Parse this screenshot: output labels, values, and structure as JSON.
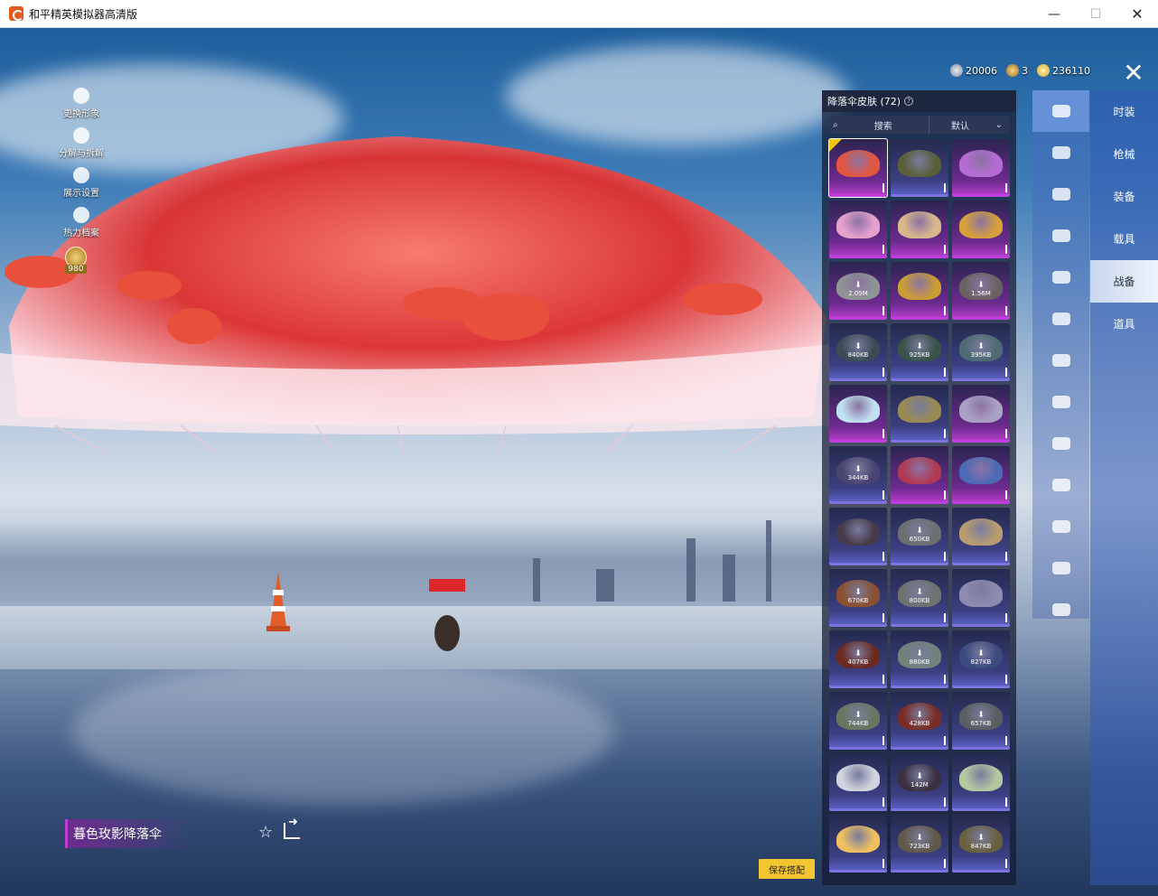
{
  "window": {
    "title": "和平精英模拟器高清版",
    "minimize_glyph": "—",
    "maximize_glyph": "☐",
    "close_glyph": "✕"
  },
  "left_menu": {
    "items": [
      {
        "label": "更换形象",
        "icon": "avatar-icon"
      },
      {
        "label": "分解与拆解",
        "icon": "puzzle-icon"
      },
      {
        "label": "展示设置",
        "icon": "eye-icon"
      },
      {
        "label": "热力档案",
        "icon": "flame-icon"
      }
    ],
    "badge_value": "980"
  },
  "currency": {
    "items": [
      {
        "value": "20006",
        "icon": "silver-coin-icon"
      },
      {
        "value": "3",
        "icon": "gold-token-icon"
      },
      {
        "value": "236110",
        "icon": "coupon-icon"
      }
    ]
  },
  "close_label": "✕",
  "skin_panel": {
    "title": "降落伞皮肤 (72)",
    "search_placeholder": "搜索",
    "sort_label": "默认",
    "slots": [
      {
        "rarity": "purple",
        "color": "#e2553e",
        "selected": true,
        "download": ""
      },
      {
        "rarity": "blue",
        "color": "#5a5f3a",
        "download": ""
      },
      {
        "rarity": "purple",
        "color": "#b46cd4",
        "download": ""
      },
      {
        "rarity": "purple",
        "color": "#e6a1cc",
        "download": ""
      },
      {
        "rarity": "purple",
        "color": "#d8b88a",
        "download": ""
      },
      {
        "rarity": "purple",
        "color": "#d6a03a",
        "download": ""
      },
      {
        "rarity": "purple",
        "color": "#8e9494",
        "download": "2.09M"
      },
      {
        "rarity": "purple",
        "color": "#c99c34",
        "download": ""
      },
      {
        "rarity": "purple",
        "color": "#6a6262",
        "download": "1.56M"
      },
      {
        "rarity": "blue",
        "color": "#3c4a54",
        "download": "840KB"
      },
      {
        "rarity": "blue",
        "color": "#39524a",
        "download": "925KB"
      },
      {
        "rarity": "blue",
        "color": "#4e6a72",
        "download": "395KB"
      },
      {
        "rarity": "purple",
        "color": "#bfe0f0",
        "download": ""
      },
      {
        "rarity": "blue",
        "color": "#9a8a52",
        "download": ""
      },
      {
        "rarity": "purple",
        "color": "#a9a2c4",
        "download": ""
      },
      {
        "rarity": "blue",
        "color": "#4a4470",
        "download": "344KB"
      },
      {
        "rarity": "purple",
        "color": "#b03a54",
        "download": ""
      },
      {
        "rarity": "purple",
        "color": "#4d6ab6",
        "download": ""
      },
      {
        "rarity": "blue",
        "color": "#463a48",
        "download": ""
      },
      {
        "rarity": "blue",
        "color": "#6c7070",
        "download": "650KB"
      },
      {
        "rarity": "blue",
        "color": "#b89c70",
        "download": ""
      },
      {
        "rarity": "blue",
        "color": "#8a5030",
        "download": "670KB"
      },
      {
        "rarity": "blue",
        "color": "#6e7270",
        "download": "800KB"
      },
      {
        "rarity": "blue",
        "color": "#8e8ab0",
        "download": ""
      },
      {
        "rarity": "blue",
        "color": "#6a2a20",
        "download": "407KB"
      },
      {
        "rarity": "blue",
        "color": "#70827a",
        "download": "880KB"
      },
      {
        "rarity": "blue",
        "color": "#3c4a80",
        "download": "827KB"
      },
      {
        "rarity": "blue",
        "color": "#687660",
        "download": "744KB"
      },
      {
        "rarity": "blue",
        "color": "#7a2c24",
        "download": "428KB"
      },
      {
        "rarity": "blue",
        "color": "#5a5e60",
        "download": "657KB"
      },
      {
        "rarity": "blue",
        "color": "#d0d4dc",
        "download": ""
      },
      {
        "rarity": "blue",
        "color": "#3a3040",
        "download": "142M"
      },
      {
        "rarity": "blue",
        "color": "#b4c8a0",
        "download": ""
      },
      {
        "rarity": "blue",
        "color": "#f0c060",
        "download": ""
      },
      {
        "rarity": "blue",
        "color": "#60584a",
        "download": "723KB"
      },
      {
        "rarity": "blue",
        "color": "#6a6040",
        "download": "847KB"
      }
    ]
  },
  "category_icons": [
    {
      "icon": "parachute-icon",
      "active": true
    },
    {
      "icon": "airplane-trail-icon"
    },
    {
      "icon": "drone-icon"
    },
    {
      "icon": "plane-icon"
    },
    {
      "icon": "emote-face-icon"
    },
    {
      "icon": "companion-icon"
    },
    {
      "icon": "speaker-icon"
    },
    {
      "icon": "sticker-icon"
    },
    {
      "icon": "picture-icon"
    },
    {
      "icon": "grenade-icon"
    },
    {
      "icon": "finger-tap-icon"
    },
    {
      "icon": "sparkle-wand-icon"
    },
    {
      "icon": "planet-icon"
    }
  ],
  "main_tabs": [
    {
      "label": "时装"
    },
    {
      "label": "枪械"
    },
    {
      "label": "装备"
    },
    {
      "label": "载具"
    },
    {
      "label": "战备",
      "active": true
    },
    {
      "label": "道具"
    }
  ],
  "skin_name": "暮色玫影降落伞",
  "save_label": "保存搭配"
}
